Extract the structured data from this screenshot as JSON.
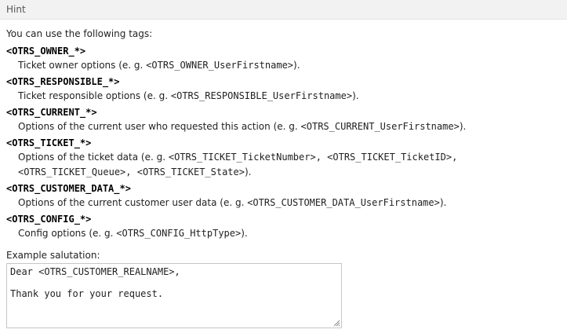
{
  "header": {
    "title": "Hint"
  },
  "intro": "You can use the following tags:",
  "tags": [
    {
      "name": "<OTRS_OWNER_*>",
      "desc_pre": "Ticket owner options (e. g. ",
      "code": "<OTRS_OWNER_UserFirstname>",
      "desc_post": ")."
    },
    {
      "name": "<OTRS_RESPONSIBLE_*>",
      "desc_pre": "Ticket responsible options (e. g. ",
      "code": "<OTRS_RESPONSIBLE_UserFirstname>",
      "desc_post": ")."
    },
    {
      "name": "<OTRS_CURRENT_*>",
      "desc_pre": "Options of the current user who requested this action (e. g. ",
      "code": "<OTRS_CURRENT_UserFirstname>",
      "desc_post": ")."
    },
    {
      "name": "<OTRS_TICKET_*>",
      "desc_pre": "Options of the ticket data (e. g. ",
      "code": "<OTRS_TICKET_TicketNumber>, <OTRS_TICKET_TicketID>,",
      "desc_line2_code": "<OTRS_TICKET_Queue>, <OTRS_TICKET_State>",
      "desc_post": ")."
    },
    {
      "name": "<OTRS_CUSTOMER_DATA_*>",
      "desc_pre": "Options of the current customer user data (e. g. ",
      "code": "<OTRS_CUSTOMER_DATA_UserFirstname>",
      "desc_post": ")."
    },
    {
      "name": "<OTRS_CONFIG_*>",
      "desc_pre": "Config options (e. g. ",
      "code": "<OTRS_CONFIG_HttpType>",
      "desc_post": ")."
    }
  ],
  "example": {
    "label": "Example salutation:",
    "text": "Dear <OTRS_CUSTOMER_REALNAME>,\n\nThank you for your request."
  }
}
